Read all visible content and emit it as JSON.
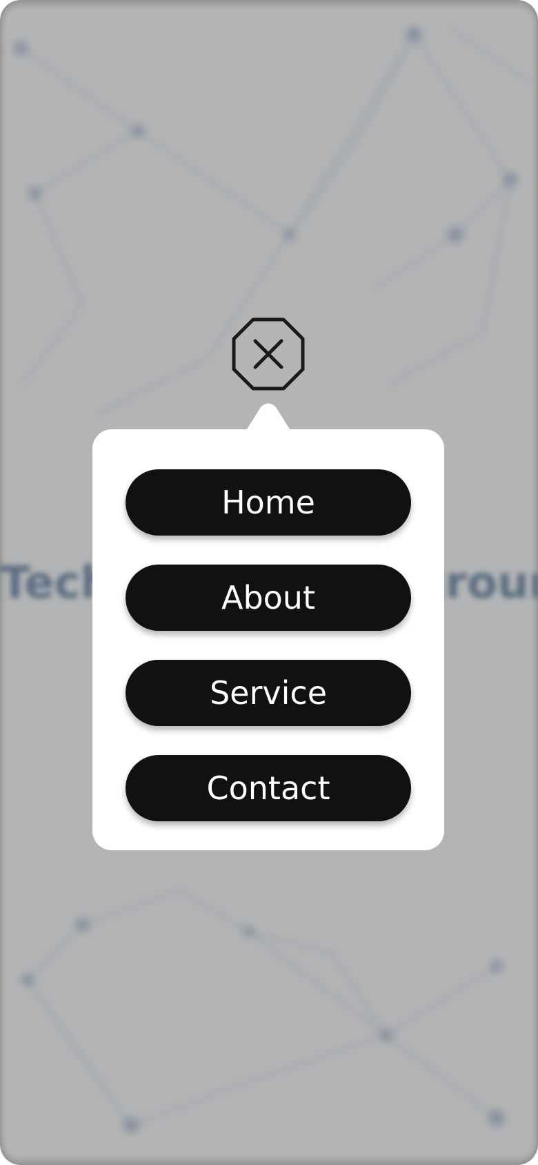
{
  "overlay": {
    "background_color": "#b3b4b5",
    "hero_text": "Technology Background"
  },
  "close": {
    "icon": "close-octagon-icon",
    "color": "#1a1a1a"
  },
  "menu": {
    "items": [
      {
        "label": "Home"
      },
      {
        "label": "About"
      },
      {
        "label": "Service"
      },
      {
        "label": "Contact"
      }
    ],
    "button_color": "#111111",
    "label_color": "#ffffff",
    "panel_color": "#ffffff"
  }
}
